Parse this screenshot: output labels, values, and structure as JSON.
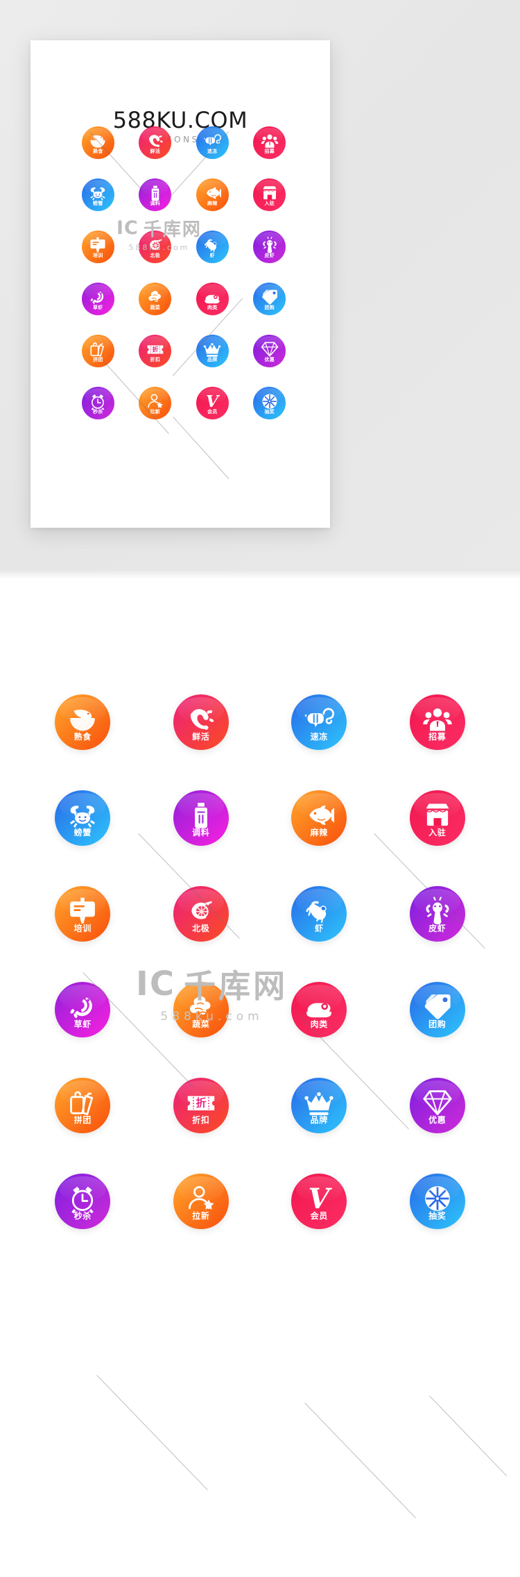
{
  "card": {
    "title": "588KU.COM",
    "subtitle": "ICONS"
  },
  "watermark": {
    "ic": "IC",
    "cn": "千库网",
    "url": "588ku.com"
  },
  "palette": {
    "orange_from": "#ffa62b",
    "orange_to": "#f94f0c",
    "pink_from": "#ec1f7b",
    "pink_to": "#fb4c23",
    "blue_from": "#2768e8",
    "blue_to": "#2ec6fb",
    "crimson_from": "#f2164f",
    "crimson_to": "#fb2e63",
    "purple_from": "#8f20d8",
    "purple_to": "#f921e0",
    "violet_from": "#7d1ee0",
    "violet_to": "#cf2bd8"
  },
  "icons": [
    {
      "label": "熟食",
      "icon": "cooked-shrimp-icon",
      "glyph": "shrimp-plate",
      "theme": "orange"
    },
    {
      "label": "鲜活",
      "icon": "live-seafood-icon",
      "glyph": "live-shrimp",
      "theme": "pink"
    },
    {
      "label": "速冻",
      "icon": "frozen-shrimp-icon",
      "glyph": "frozen-shrimp",
      "theme": "blue"
    },
    {
      "label": "招募",
      "icon": "recruit-people-icon",
      "glyph": "people",
      "theme": "crimson"
    },
    {
      "label": "螃蟹",
      "icon": "crab-icon",
      "glyph": "crab",
      "theme": "blue"
    },
    {
      "label": "调料",
      "icon": "seasoning-bottle-icon",
      "glyph": "seasoning",
      "theme": "purple"
    },
    {
      "label": "麻辣",
      "icon": "spicy-fish-icon",
      "glyph": "fish",
      "theme": "orange"
    },
    {
      "label": "入驻",
      "icon": "shop-entry-icon",
      "glyph": "shop",
      "theme": "crimson"
    },
    {
      "label": "培训",
      "icon": "training-board-icon",
      "glyph": "board",
      "theme": "orange"
    },
    {
      "label": "北极",
      "icon": "arctic-shrimp-icon",
      "glyph": "arctic-shrimp",
      "theme": "pink"
    },
    {
      "label": "虾",
      "icon": "shrimp-icon",
      "glyph": "shrimp",
      "theme": "blue"
    },
    {
      "label": "皮虾",
      "icon": "mantis-shrimp-icon",
      "glyph": "lobster",
      "theme": "violet"
    },
    {
      "label": "草虾",
      "icon": "grass-shrimp-icon",
      "glyph": "curled-shrimp",
      "theme": "purple"
    },
    {
      "label": "蔬菜",
      "icon": "vegetable-icon",
      "glyph": "vegetable",
      "theme": "orange"
    },
    {
      "label": "肉类",
      "icon": "meat-icon",
      "glyph": "meat",
      "theme": "crimson"
    },
    {
      "label": "团购",
      "icon": "group-buy-tag-icon",
      "glyph": "tag",
      "theme": "blue"
    },
    {
      "label": "拼团",
      "icon": "group-purchase-icon",
      "glyph": "double-tag",
      "theme": "orange"
    },
    {
      "label": "折扣",
      "icon": "discount-ticket-icon",
      "glyph": "ticket",
      "theme": "pink"
    },
    {
      "label": "品牌",
      "icon": "brand-crown-icon",
      "glyph": "crown",
      "theme": "blue"
    },
    {
      "label": "优惠",
      "icon": "benefit-diamond-icon",
      "glyph": "diamond",
      "theme": "violet"
    },
    {
      "label": "秒杀",
      "icon": "flash-sale-clock-icon",
      "glyph": "alarm",
      "theme": "violet"
    },
    {
      "label": "拉新",
      "icon": "referral-user-icon",
      "glyph": "user-star",
      "theme": "orange"
    },
    {
      "label": "会员",
      "icon": "vip-member-icon",
      "glyph": "v-mark",
      "theme": "crimson"
    },
    {
      "label": "抽奖",
      "icon": "lucky-draw-wheel-icon",
      "glyph": "wheel",
      "theme": "blue"
    }
  ],
  "discount_ticket_text": "折",
  "vip_text": "V"
}
